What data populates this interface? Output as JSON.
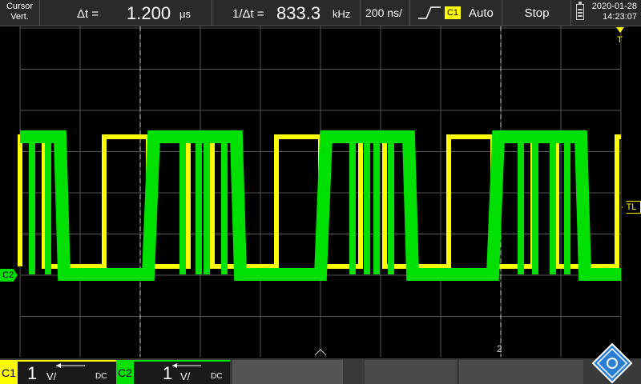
{
  "topbar": {
    "cursor_mode_line1": "Cursor",
    "cursor_mode_line2": "Vert.",
    "delta_t_label": "Δt =",
    "delta_t_value": "1.200",
    "delta_t_unit": "μs",
    "inv_delta_t_label": "1/Δt =",
    "inv_delta_t_value": "833.3",
    "inv_delta_t_unit": "kHz",
    "timebase": "200 ns/",
    "trigger_source": "C1",
    "trigger_mode": "Auto",
    "run_state": "Stop",
    "date": "2020-01-28",
    "time": "14:23:07"
  },
  "screen": {
    "ch2_marker": "C2",
    "trigger_level_marker": "TL",
    "trigger_position_marker": "T",
    "cursor2_label": "2"
  },
  "bottombar": {
    "ch1": {
      "name": "C1",
      "scale": "1",
      "unit": "V/",
      "coupling": "DC"
    },
    "ch2": {
      "name": "C2",
      "scale": "1",
      "unit": "V/",
      "coupling": "DC"
    }
  },
  "colors": {
    "ch1": "#ffff00",
    "ch2": "#00e000",
    "grid": "#555555",
    "background": "#000000",
    "statusbar": "#2a2a2a"
  }
}
